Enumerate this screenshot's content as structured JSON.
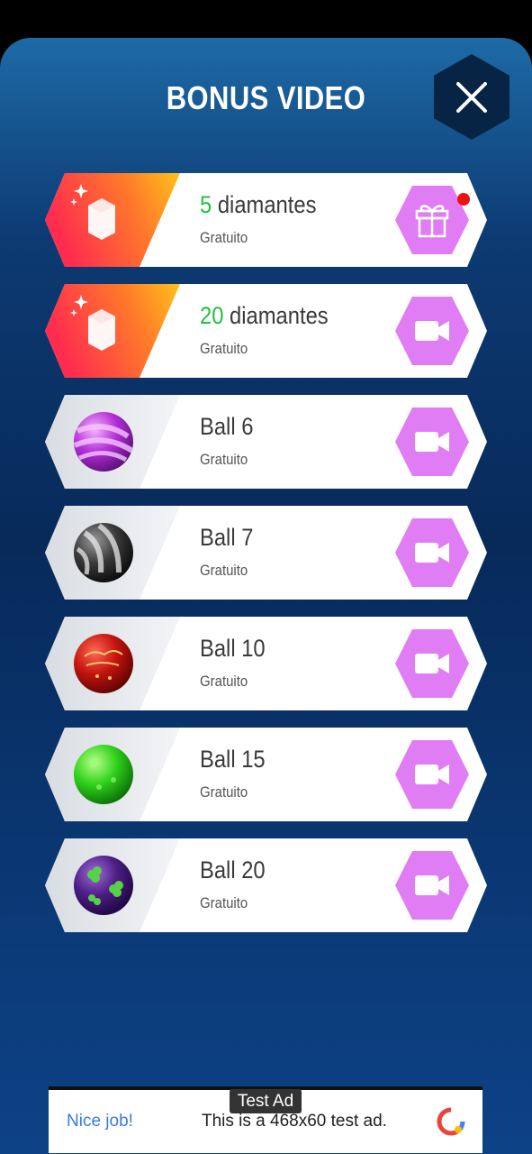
{
  "header": {
    "title": "BONUS VIDEO"
  },
  "rows": [
    {
      "amount": "5",
      "label": "diamantes",
      "subtitle": "Gratuito",
      "reward": "diamond",
      "action": "gift"
    },
    {
      "amount": "20",
      "label": "diamantes",
      "subtitle": "Gratuito",
      "reward": "diamond",
      "action": "video"
    },
    {
      "label": "Ball 6",
      "subtitle": "Gratuito",
      "reward": "ball-purple-striped",
      "action": "video"
    },
    {
      "label": "Ball 7",
      "subtitle": "Gratuito",
      "reward": "ball-black-striped",
      "action": "video"
    },
    {
      "label": "Ball 10",
      "subtitle": "Gratuito",
      "reward": "ball-red-christmas",
      "action": "video"
    },
    {
      "label": "Ball 15",
      "subtitle": "Gratuito",
      "reward": "ball-green",
      "action": "video"
    },
    {
      "label": "Ball 20",
      "subtitle": "Gratuito",
      "reward": "ball-purple-clover",
      "action": "video"
    }
  ],
  "ad": {
    "label": "Test Ad",
    "nice": "Nice job!",
    "text": "This is a 468x60 test ad."
  },
  "colors": {
    "accent_green": "#1ec23a",
    "action_button": "#e07df5",
    "diamond_gradient_start": "#ff3a4a",
    "diamond_gradient_end": "#ffc21a",
    "notification_dot": "#ee1111"
  }
}
